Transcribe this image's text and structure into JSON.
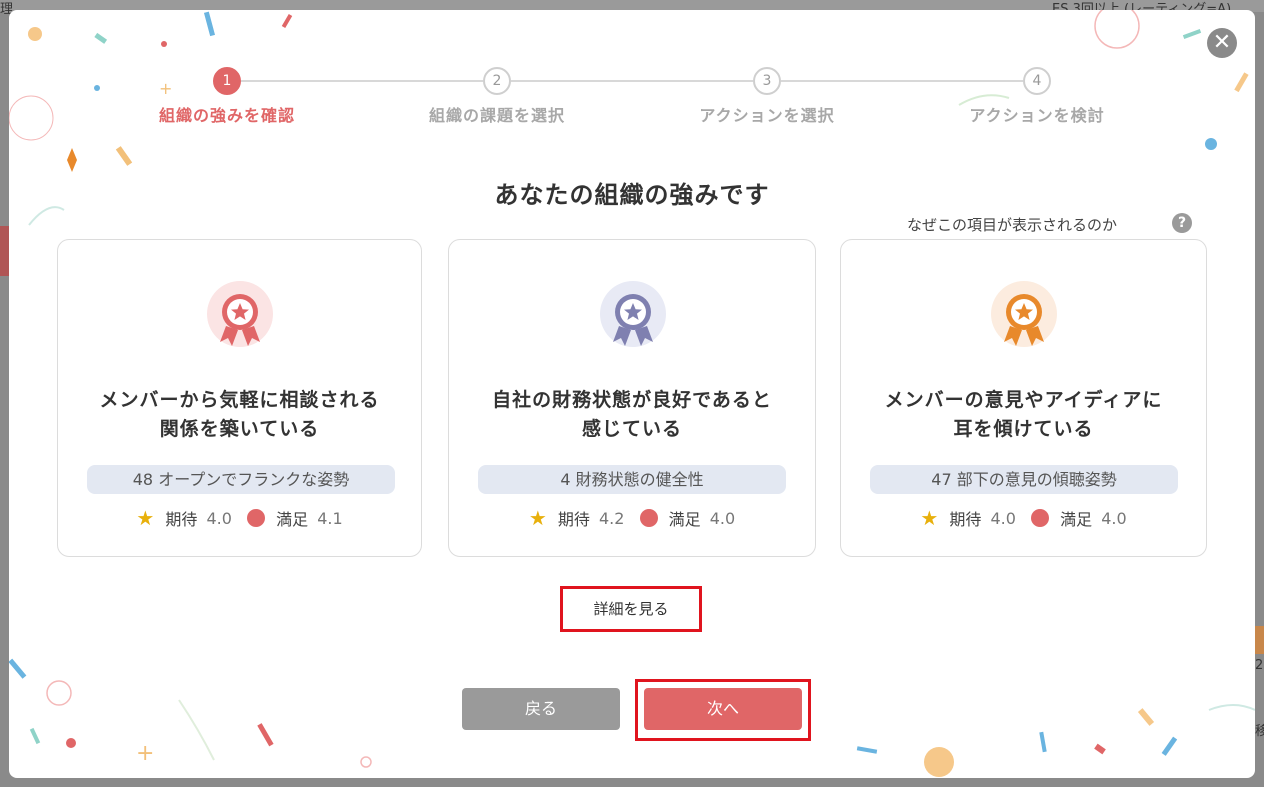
{
  "background": {
    "left_text": "理",
    "right_text": "ES 3回以上 (レーティング=A)",
    "side_number": "2",
    "side_char": "移"
  },
  "colors": {
    "accent": "#e06667",
    "chip_bg": "#e3e8f2",
    "star": "#e8b00c",
    "highlight_frame": "#e0141e"
  },
  "stepper": {
    "steps": [
      {
        "number": "1",
        "label": "組織の強みを確認",
        "active": true
      },
      {
        "number": "2",
        "label": "組織の課題を選択",
        "active": false
      },
      {
        "number": "3",
        "label": "アクションを選択",
        "active": false
      },
      {
        "number": "4",
        "label": "アクションを検討",
        "active": false
      }
    ]
  },
  "main": {
    "title": "あなたの組織の強みです",
    "why_link": "なぜこの項目が表示されるのか",
    "why_icon": "?",
    "close_icon": "✕"
  },
  "cards": [
    {
      "badge_icon": "award-ribbon-red-icon",
      "title_line1": "メンバーから気軽に相談される",
      "title_line2": "関係を築いている",
      "chip": "48 オープンでフランクな姿勢",
      "expect_label": "期待",
      "expect_value": "4.0",
      "satisfy_label": "満足",
      "satisfy_value": "4.1"
    },
    {
      "badge_icon": "award-ribbon-purple-icon",
      "title_line1": "自社の財務状態が良好であると",
      "title_line2": "感じている",
      "chip": "4 財務状態の健全性",
      "expect_label": "期待",
      "expect_value": "4.2",
      "satisfy_label": "満足",
      "satisfy_value": "4.0"
    },
    {
      "badge_icon": "award-ribbon-orange-icon",
      "title_line1": "メンバーの意見やアイディアに",
      "title_line2": "耳を傾けている",
      "chip": "47 部下の意見の傾聴姿勢",
      "expect_label": "期待",
      "expect_value": "4.0",
      "satisfy_label": "満足",
      "satisfy_value": "4.0"
    }
  ],
  "actions": {
    "detail": "詳細を見る",
    "back": "戻る",
    "next": "次へ"
  }
}
